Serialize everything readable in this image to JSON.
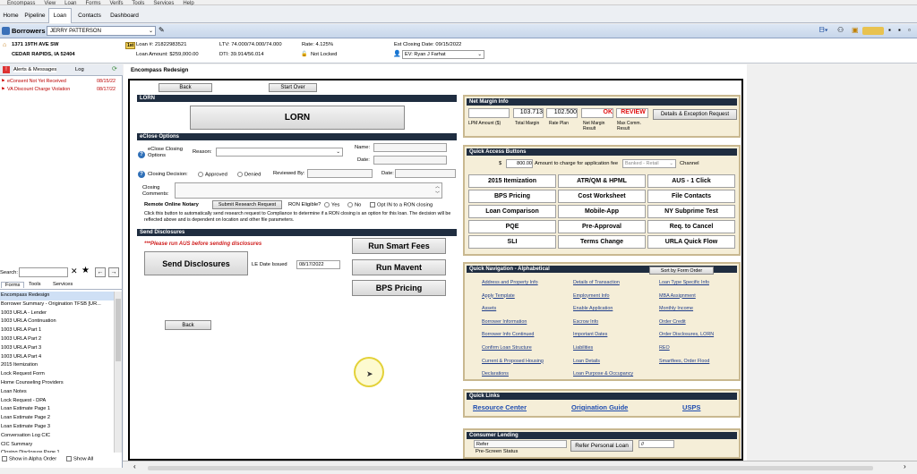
{
  "menu": [
    "Encompass",
    "View",
    "Loan",
    "Forms",
    "Verifs",
    "Tools",
    "Services",
    "Help"
  ],
  "tabs": [
    "Home",
    "Pipeline",
    "Loan",
    "Contacts",
    "Dashboard"
  ],
  "borrowers": {
    "label": "Borrowers",
    "selected": "JERRY PATTERSON"
  },
  "info": {
    "address1": "1371 19TH AVE SW",
    "address2": "CEDAR RAPIDS, IA 52404",
    "lien": "1st",
    "loan_no": "Loan #: 21822983521",
    "loan_amount": "Loan Amount: $259,000.00",
    "ltv": "LTV: 74.000/74.000/74.000",
    "dti": "DTI: 39.914/56.014",
    "rate": "Rate: 4.125%",
    "lock": "Not Locked",
    "est_closing": "Est Closing Date: 09/15/2022",
    "ev": "EV: Ryan J Farhat"
  },
  "left": {
    "alerts_tab": "Alerts & Messages",
    "log_tab": "Log",
    "alerts": [
      {
        "text": "eConsent Not Yet Received",
        "date": "08/15/22"
      },
      {
        "text": "VA Discount Charge Violation",
        "date": "08/17/22"
      }
    ],
    "search_label": "Search:",
    "form_tabs": [
      "Forms",
      "Tools",
      "Services"
    ],
    "forms": [
      "Encompass Redesign",
      "Borrower Summary - Origination TFSB [UR...",
      "1003 URLA - Lender",
      "1003 URLA Continuation",
      "1003 URLA Part 1",
      "1003 URLA Part 2",
      "1003 URLA Part 3",
      "1003 URLA Part 4",
      "2015 Itemization",
      "Lock Request Form",
      "Home Counseling Providers",
      "Loan Notes",
      "Lock Request - DPA",
      "Loan Estimate Page 1",
      "Loan Estimate Page 2",
      "Loan Estimate Page 3",
      "Conversation Log CIC",
      "CIC Summary",
      "Closing Disclosure Page 1"
    ],
    "alpha_order": "Show in Alpha Order",
    "show_all": "Show All"
  },
  "form_title": "Encompass Redesign",
  "form": {
    "back": "Back",
    "start_over": "Start Over",
    "lorn_header": "LORN",
    "lorn_button": "LORN",
    "eclose_header": "eClose Options",
    "eclose_label": "eClose Closing Options",
    "reason_label": "Reason:",
    "name_label": "Name:",
    "date_label": "Date:",
    "closing_decision": "Closing Decision:",
    "approved": "Approved",
    "denied": "Denied",
    "reviewed_by": "Reviewed By:",
    "date2": "Date:",
    "closing_comments": "Closing Comments:",
    "ron_label": "Remote Online Notary",
    "submit_research": "Submit Research Request",
    "ron_eligible": "RON Eligible?",
    "yes": "Yes",
    "no": "No",
    "opt_in": "Opt IN to a RON closing",
    "ron_note": "Click this button to automatically send research request to Compliance to determine if a RON closing is an option for this loan.  The decision will be reflected above and is dependent on location and other file parameters.",
    "send_header": "Send Disclosures",
    "warning": "***Please run AUS before sending disclosures",
    "send_btn": "Send Disclosures",
    "le_date_label": "LE Date Issued",
    "le_date": "08/17/2022",
    "run_smart_fees": "Run Smart Fees",
    "run_mavent": "Run Mavent",
    "bps_pricing": "BPS Pricing",
    "back2": "Back"
  },
  "net_margin": {
    "header": "Net Margin Info",
    "v1": "",
    "v2": "103.713",
    "v3": "102.500",
    "v4": "OK",
    "v5": "REVIEW",
    "l1": "LPM Amount ($)",
    "l2": "Total Margin",
    "l3": "Rate Plan",
    "l4": "Net Margin Result",
    "l5": "Max Comm. Result",
    "button": "Details & Exception Request"
  },
  "quick_access": {
    "header": "Quick Access Buttons",
    "dollar": "$",
    "amount": "800.00",
    "amount_label": "Amount to charge for application fee",
    "channel_value": "Banked - Retail",
    "channel_label": "Channel",
    "buttons": [
      "2015 Itemization",
      "ATR/QM & HPML",
      "AUS - 1 Click",
      "BPS Pricing",
      "Cost Worksheet",
      "File Contacts",
      "Loan Comparison",
      "Mobile-App",
      "NY Subprime Test",
      "PQE",
      "Pre-Approval",
      "Req. to Cancel",
      "SLI",
      "Terms Change",
      "URLA Quick Flow"
    ]
  },
  "quick_nav": {
    "header": "Quick Navigation - Alphabetical",
    "sort_btn": "Sort by Form Order",
    "col1": [
      "Address and Property Info",
      "Apply Template",
      "Assets",
      "Borrower Information",
      "Borrower Info Continued",
      "Confirm Loan Structure",
      "Current & Proposed Housing",
      "Declarations"
    ],
    "col2": [
      "Details of Transaction",
      "Employment Info",
      "Enable Application",
      "Escrow Info",
      "Important Dates",
      "Liabilities",
      "Loan Details",
      "Loan Purpose & Occupancy"
    ],
    "col3": [
      "Loan Type Specific Info",
      "MBA Assignment",
      "Monthly Income",
      "Order Credit",
      "Order Disclosures, LORN",
      "REO",
      "Smartfees, Order Flood"
    ]
  },
  "quick_links": {
    "header": "Quick Links",
    "links": [
      "Resource Center",
      "Origination Guide",
      "USPS"
    ]
  },
  "consumer": {
    "header": "Consumer Lending",
    "refer": "Refer",
    "status_label": "Pre-Screen Status",
    "button": "Refer Personal Loan",
    "field": "//"
  }
}
